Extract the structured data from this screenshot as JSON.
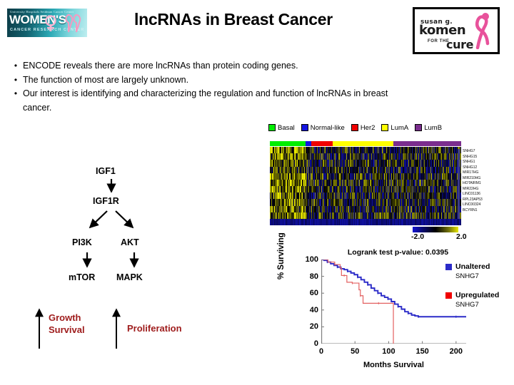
{
  "header": {
    "title": "lncRNAs in Breast Cancer",
    "wcrc_logo": {
      "top_line": "University Hospitals Seidman Cancer Center",
      "main": "WOMEN'S",
      "sub": "CANCER    RESEARCH CENTER",
      "ribbon_icon": "pink-ribbon-icon"
    },
    "komen_logo": {
      "line1": "susan g.",
      "line2": "komen",
      "line3": "FOR THE",
      "line4": "cure",
      "ribbon_icon": "pink-ribbon-icon"
    }
  },
  "bullets": [
    "ENCODE reveals there are more lncRNAs than protein coding genes.",
    "The function of most are largely unknown.",
    "Our interest is identifying and characterizing the regulation and function of lncRNAs in breast cancer."
  ],
  "heatmap": {
    "legend": [
      {
        "label": "Basal",
        "color": "#00EE00"
      },
      {
        "label": "Normal-like",
        "color": "#1414E0"
      },
      {
        "label": "Her2",
        "color": "#F00000"
      },
      {
        "label": "LumA",
        "color": "#FFFF00"
      },
      {
        "label": "LumB",
        "color": "#7B2D8E"
      }
    ],
    "class_bar": [
      {
        "subtype": "Basal",
        "color": "#00EE00",
        "fraction": 0.185
      },
      {
        "subtype": "Normal-like",
        "color": "#1414E0",
        "fraction": 0.033
      },
      {
        "subtype": "Her2",
        "color": "#F00000",
        "fraction": 0.112
      },
      {
        "subtype": "LumA",
        "color": "#FFFF00",
        "fraction": 0.315
      },
      {
        "subtype": "LumB",
        "color": "#7B2D8E",
        "fraction": 0.355
      }
    ],
    "genes": [
      "SNHG7",
      "SNHG15",
      "SNHG1",
      "SNHG12",
      "MIR17HG",
      "MIR210HG",
      "HOTAIRM1",
      "MIR22HG",
      "LINC01136",
      "RPL23AP53",
      "LINC00324",
      "BCYRN1"
    ],
    "scale": {
      "low": "-2.0",
      "high": "2.0",
      "low_color": "#1414d2",
      "mid_color": "#000000",
      "high_color": "#e8e800"
    }
  },
  "pathway": {
    "nodes": [
      "IGF1",
      "IGF1R",
      "PI3K",
      "AKT",
      "mTOR",
      "MAPK"
    ],
    "outcomes": [
      {
        "lines": [
          "Growth",
          "Survival"
        ],
        "color": "#9E1B1B",
        "arrow": "up-arrow-icon"
      },
      {
        "lines": [
          "Proliferation"
        ],
        "color": "#9E1B1B",
        "arrow": "up-arrow-icon"
      }
    ]
  },
  "chart_data": {
    "type": "line",
    "title": "Logrank test p-value: 0.0395",
    "xlabel": "Months Survival",
    "ylabel": "% Surviving",
    "xlim": [
      0,
      215
    ],
    "ylim": [
      0,
      100
    ],
    "xticks": [
      0,
      50,
      100,
      150,
      200
    ],
    "yticks": [
      0,
      20,
      40,
      60,
      80,
      100
    ],
    "grid": false,
    "legend_position": "right",
    "series": [
      {
        "name": "Unaltered SNHG7",
        "color": "#2B2BC8",
        "x": [
          0,
          4,
          9,
          14,
          19,
          24,
          29,
          34,
          39,
          44,
          49,
          54,
          59,
          64,
          69,
          74,
          79,
          84,
          89,
          94,
          99,
          104,
          109,
          114,
          119,
          124,
          129,
          134,
          139,
          144,
          160,
          180,
          200,
          215
        ],
        "y": [
          100,
          99,
          97,
          95,
          93,
          91,
          89,
          88,
          86,
          84,
          82,
          79,
          76,
          73,
          70,
          66,
          63,
          60,
          57,
          55,
          53,
          50,
          47,
          44,
          41,
          38,
          36,
          34,
          33,
          32,
          32,
          32,
          32,
          32
        ]
      },
      {
        "name": "Upregulated SNHG7",
        "color": "#E36060",
        "x": [
          0,
          10,
          20,
          28,
          30,
          34,
          38,
          42,
          46,
          52,
          56,
          58,
          62,
          70,
          85,
          100,
          107,
          107
        ],
        "y": [
          100,
          97,
          94,
          90,
          81,
          81,
          73,
          73,
          72,
          72,
          64,
          57,
          48,
          48,
          48,
          48,
          48,
          0
        ]
      }
    ],
    "legend": [
      {
        "label_line1": "Unaltered",
        "label_line2": "SNHG7",
        "color": "#2B2BC8"
      },
      {
        "label_line1": "Upregulated",
        "label_line2": "SNHG7",
        "color": "#F00000"
      }
    ]
  }
}
